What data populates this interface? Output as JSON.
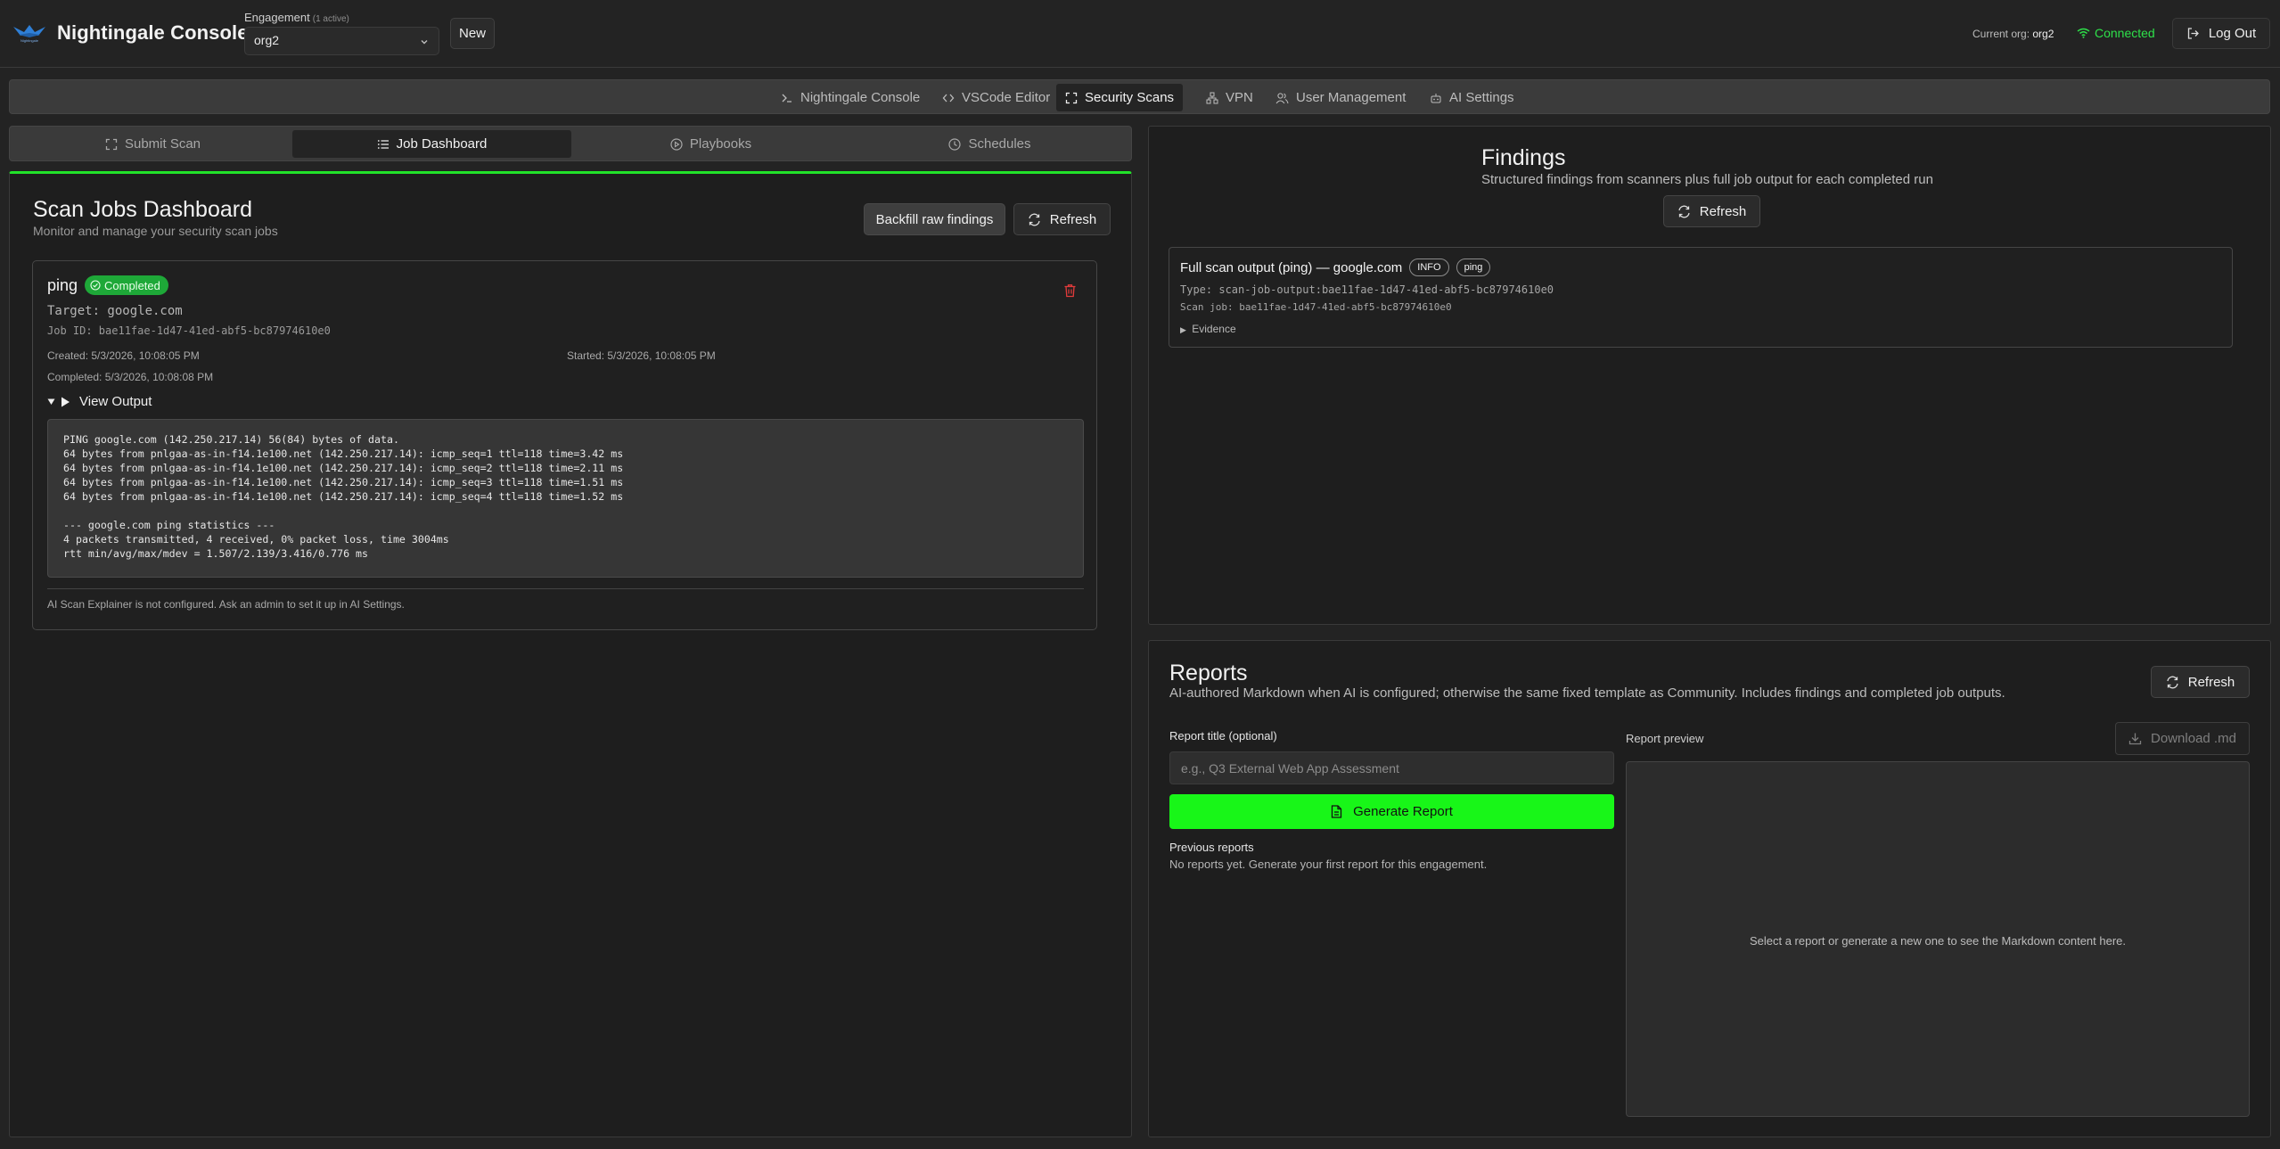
{
  "header": {
    "app_title": "Nightingale Console",
    "logo_text": "Nightingale",
    "engagement_label": "Engagement",
    "engagement_active": "(1 active)",
    "engagement_value": "org2",
    "new_label": "New",
    "org_label": "Current org:",
    "org_value": "org2",
    "status": "Connected",
    "logout_label": "Log Out"
  },
  "nav": {
    "items": [
      {
        "label": "Nightingale Console",
        "icon": "terminal-icon"
      },
      {
        "label": "VSCode Editor",
        "icon": "code-icon"
      },
      {
        "label": "Security Scans",
        "icon": "scan-icon"
      },
      {
        "label": "VPN",
        "icon": "network-icon"
      },
      {
        "label": "User Management",
        "icon": "users-icon"
      },
      {
        "label": "AI Settings",
        "icon": "bot-icon"
      }
    ],
    "active": "Security Scans"
  },
  "subtabs": {
    "items": [
      {
        "label": "Submit Scan",
        "icon": "scan-icon"
      },
      {
        "label": "Job Dashboard",
        "icon": "list-icon"
      },
      {
        "label": "Playbooks",
        "icon": "play-icon"
      },
      {
        "label": "Schedules",
        "icon": "clock-icon"
      }
    ],
    "active": "Job Dashboard"
  },
  "dashboard": {
    "title": "Scan Jobs Dashboard",
    "subtitle": "Monitor and manage your security scan jobs",
    "backfill_label": "Backfill raw findings",
    "refresh_label": "Refresh",
    "job": {
      "name": "ping",
      "status": "Completed",
      "target": "Target: google.com",
      "job_id": "Job ID: bae11fae-1d47-41ed-abf5-bc87974610e0",
      "created": "Created: 5/3/2026, 10:08:05 PM",
      "started": "Started: 5/3/2026, 10:08:05 PM",
      "completed": "Completed: 5/3/2026, 10:08:08 PM",
      "view_output_label": "View Output",
      "output": "PING google.com (142.250.217.14) 56(84) bytes of data.\n64 bytes from pnlgaa-as-in-f14.1e100.net (142.250.217.14): icmp_seq=1 ttl=118 time=3.42 ms\n64 bytes from pnlgaa-as-in-f14.1e100.net (142.250.217.14): icmp_seq=2 ttl=118 time=2.11 ms\n64 bytes from pnlgaa-as-in-f14.1e100.net (142.250.217.14): icmp_seq=3 ttl=118 time=1.51 ms\n64 bytes from pnlgaa-as-in-f14.1e100.net (142.250.217.14): icmp_seq=4 ttl=118 time=1.52 ms\n\n--- google.com ping statistics ---\n4 packets transmitted, 4 received, 0% packet loss, time 3004ms\nrtt min/avg/max/mdev = 1.507/2.139/3.416/0.776 ms",
      "explainer_note": "AI Scan Explainer is not configured. Ask an admin to set it up in AI Settings."
    }
  },
  "findings": {
    "title": "Findings",
    "subtitle": "Structured findings from scanners plus full job output for each completed run",
    "refresh_label": "Refresh",
    "item": {
      "title": "Full scan output (ping) — google.com",
      "severity": "INFO",
      "tag": "ping",
      "type": "Type: scan-job-output:bae11fae-1d47-41ed-abf5-bc87974610e0",
      "scan_job": "Scan job: bae11fae-1d47-41ed-abf5-bc87974610e0",
      "evidence_label": "Evidence"
    }
  },
  "reports": {
    "title": "Reports",
    "subtitle": "AI-authored Markdown when AI is configured; otherwise the same fixed template as Community. Includes findings and completed job outputs.",
    "refresh_label": "Refresh",
    "title_label": "Report title (optional)",
    "title_placeholder": "e.g., Q3 External Web App Assessment",
    "generate_label": "Generate Report",
    "previous_label": "Previous reports",
    "previous_empty": "No reports yet. Generate your first report for this engagement.",
    "preview_label": "Report preview",
    "download_label": "Download .md",
    "preview_empty": "Select a report or generate a new one to see the Markdown content here."
  },
  "colors": {
    "accent_green": "#18f618",
    "status_connected": "#2ee04a",
    "badge_completed": "#1ea838",
    "delete_red": "#e23b3b"
  }
}
